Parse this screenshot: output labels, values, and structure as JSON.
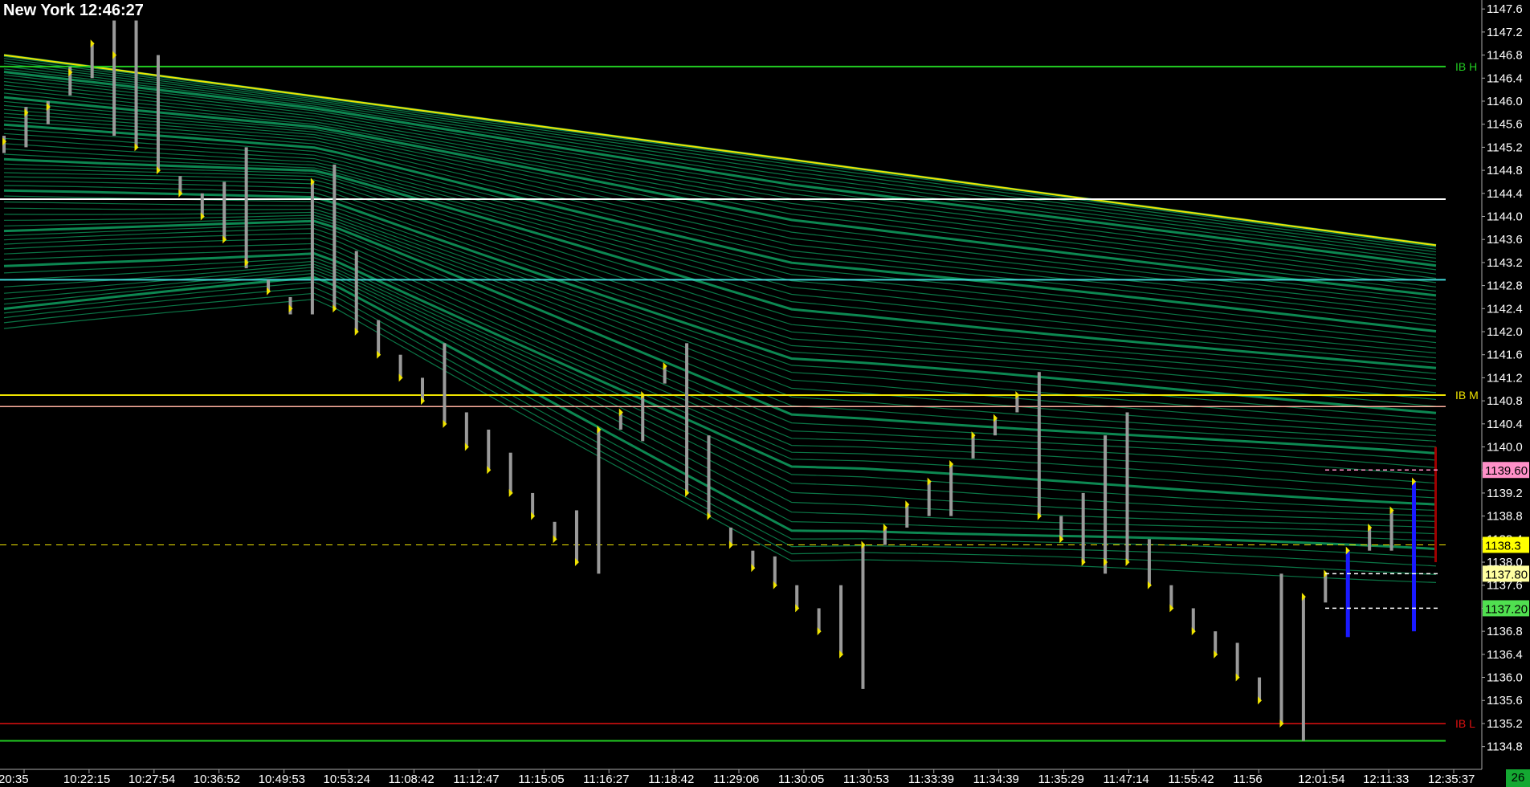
{
  "header": {
    "title": "New York 12:46:27"
  },
  "status": {
    "bar_count": "26"
  },
  "colors": {
    "background": "#000000",
    "fan": "#0d8a52",
    "fan_band": "#0fa060",
    "fan_top": "#f0e400",
    "bar": "#9a9a9a",
    "tick_mark": "#f0e400",
    "ib_high": "#22cc22",
    "ib_mid": "#f0e400",
    "ib_low": "#e01010",
    "white_line": "#ffffff",
    "cyan_line": "#40d8d8",
    "salmon_line": "#ffb0a0",
    "current_bar": "#1a1aff",
    "range_bar": "#a00000"
  },
  "chart_data": {
    "type": "bar",
    "ylim": [
      1134.6,
      1147.7
    ],
    "y_ticks": [
      "1147.6",
      "1147.2",
      "1146.8",
      "1146.4",
      "1146.0",
      "1145.6",
      "1145.2",
      "1144.8",
      "1144.4",
      "1144.0",
      "1143.6",
      "1143.2",
      "1142.8",
      "1142.4",
      "1142.0",
      "1141.6",
      "1141.2",
      "1140.8",
      "1140.4",
      "1140.0",
      "1139.6",
      "1139.2",
      "1138.8",
      "1138.4",
      "1138.0",
      "1137.6",
      "1137.2",
      "1136.8",
      "1136.4",
      "1136.0",
      "1135.6",
      "1135.2",
      "1134.8"
    ],
    "x_labels": [
      "20:35",
      "10:22:15",
      "10:27:54",
      "10:36:52",
      "10:49:53",
      "10:53:24",
      "11:08:42",
      "11:12:47",
      "11:15:05",
      "11:16:27",
      "11:18:42",
      "11:29:06",
      "11:30:05",
      "11:30:53",
      "11:33:39",
      "11:34:39",
      "11:35:29",
      "11:47:14",
      "11:55:42",
      "11:56",
      "12:01:54",
      "12:11:33",
      "12:35:37"
    ],
    "levels": [
      {
        "label": "IB H",
        "value": 1146.6,
        "style": "ib_high"
      },
      {
        "label": "",
        "value": 1144.3,
        "style": "white_line"
      },
      {
        "label": "",
        "value": 1142.9,
        "style": "cyan_line"
      },
      {
        "label": "IB M",
        "value": 1140.9,
        "style": "ib_mid"
      },
      {
        "label": "",
        "value": 1140.7,
        "style": "salmon_line"
      },
      {
        "label": "",
        "value": 1138.3,
        "style": "ib_mid_dash"
      },
      {
        "label": "IB L",
        "value": 1135.2,
        "style": "ib_low"
      },
      {
        "label": "",
        "value": 1134.9,
        "style": "ib_high"
      }
    ],
    "price_labels": [
      {
        "text": "1139.60",
        "value": 1139.6,
        "bg": "#ff90c8"
      },
      {
        "text": "1138.3",
        "value": 1138.3,
        "bg": "#ffff00"
      },
      {
        "text": "1137.80",
        "value": 1137.8,
        "bg": "#ffffa0"
      },
      {
        "text": "1137.20",
        "value": 1137.2,
        "bg": "#50e050"
      }
    ],
    "bars": [
      {
        "high": 1145.4,
        "low": 1145.1,
        "close": 1145.3
      },
      {
        "high": 1145.9,
        "low": 1145.2,
        "close": 1145.8
      },
      {
        "high": 1146.0,
        "low": 1145.6,
        "close": 1145.9
      },
      {
        "high": 1146.6,
        "low": 1146.1,
        "close": 1146.5
      },
      {
        "high": 1147.0,
        "low": 1146.4,
        "close": 1147.0
      },
      {
        "high": 1147.4,
        "low": 1145.4,
        "close": 1146.8
      },
      {
        "high": 1147.4,
        "low": 1145.2,
        "close": 1145.2
      },
      {
        "high": 1146.8,
        "low": 1144.8,
        "close": 1144.8
      },
      {
        "high": 1144.7,
        "low": 1144.4,
        "close": 1144.4
      },
      {
        "high": 1144.4,
        "low": 1144.0,
        "close": 1144.0
      },
      {
        "high": 1144.6,
        "low": 1143.6,
        "close": 1143.6
      },
      {
        "high": 1145.2,
        "low": 1143.1,
        "close": 1143.2
      },
      {
        "high": 1142.9,
        "low": 1142.7,
        "close": 1142.7
      },
      {
        "high": 1142.6,
        "low": 1142.3,
        "close": 1142.4
      },
      {
        "high": 1144.6,
        "low": 1142.3,
        "close": 1144.6
      },
      {
        "high": 1144.9,
        "low": 1142.4,
        "close": 1142.4
      },
      {
        "high": 1143.4,
        "low": 1142.0,
        "close": 1142.0
      },
      {
        "high": 1142.2,
        "low": 1141.6,
        "close": 1141.6
      },
      {
        "high": 1141.6,
        "low": 1141.2,
        "close": 1141.2
      },
      {
        "high": 1141.2,
        "low": 1140.8,
        "close": 1140.8
      },
      {
        "high": 1141.8,
        "low": 1140.4,
        "close": 1140.4
      },
      {
        "high": 1140.6,
        "low": 1140.0,
        "close": 1140.0
      },
      {
        "high": 1140.3,
        "low": 1139.6,
        "close": 1139.6
      },
      {
        "high": 1139.9,
        "low": 1139.2,
        "close": 1139.2
      },
      {
        "high": 1139.2,
        "low": 1138.8,
        "close": 1138.8
      },
      {
        "high": 1138.7,
        "low": 1138.4,
        "close": 1138.4
      },
      {
        "high": 1138.9,
        "low": 1138.0,
        "close": 1138.0
      },
      {
        "high": 1140.3,
        "low": 1137.8,
        "close": 1140.3
      },
      {
        "high": 1140.6,
        "low": 1140.3,
        "close": 1140.6
      },
      {
        "high": 1140.9,
        "low": 1140.1,
        "close": 1140.9
      },
      {
        "high": 1141.4,
        "low": 1141.1,
        "close": 1141.4
      },
      {
        "high": 1141.8,
        "low": 1139.2,
        "close": 1139.2
      },
      {
        "high": 1140.2,
        "low": 1138.8,
        "close": 1138.8
      },
      {
        "high": 1138.6,
        "low": 1138.3,
        "close": 1138.3
      },
      {
        "high": 1138.2,
        "low": 1137.9,
        "close": 1137.9
      },
      {
        "high": 1138.1,
        "low": 1137.6,
        "close": 1137.6
      },
      {
        "high": 1137.6,
        "low": 1137.2,
        "close": 1137.2
      },
      {
        "high": 1137.2,
        "low": 1136.8,
        "close": 1136.8
      },
      {
        "high": 1137.6,
        "low": 1136.4,
        "close": 1136.4
      },
      {
        "high": 1138.3,
        "low": 1135.8,
        "close": 1138.3
      },
      {
        "high": 1138.6,
        "low": 1138.3,
        "close": 1138.6
      },
      {
        "high": 1139.0,
        "low": 1138.6,
        "close": 1139.0
      },
      {
        "high": 1139.4,
        "low": 1138.8,
        "close": 1139.4
      },
      {
        "high": 1139.7,
        "low": 1138.8,
        "close": 1139.7
      },
      {
        "high": 1140.2,
        "low": 1139.8,
        "close": 1140.2
      },
      {
        "high": 1140.5,
        "low": 1140.2,
        "close": 1140.5
      },
      {
        "high": 1140.9,
        "low": 1140.6,
        "close": 1140.9
      },
      {
        "high": 1141.3,
        "low": 1138.8,
        "close": 1138.8
      },
      {
        "high": 1138.8,
        "low": 1138.4,
        "close": 1138.4
      },
      {
        "high": 1139.2,
        "low": 1138.0,
        "close": 1138.0
      },
      {
        "high": 1140.2,
        "low": 1137.8,
        "close": 1138.0
      },
      {
        "high": 1140.6,
        "low": 1138.0,
        "close": 1138.0
      },
      {
        "high": 1138.4,
        "low": 1137.6,
        "close": 1137.6
      },
      {
        "high": 1137.6,
        "low": 1137.2,
        "close": 1137.2
      },
      {
        "high": 1137.2,
        "low": 1136.8,
        "close": 1136.8
      },
      {
        "high": 1136.8,
        "low": 1136.4,
        "close": 1136.4
      },
      {
        "high": 1136.6,
        "low": 1136.0,
        "close": 1136.0
      },
      {
        "high": 1136.0,
        "low": 1135.6,
        "close": 1135.6
      },
      {
        "high": 1137.8,
        "low": 1135.2,
        "close": 1135.2
      },
      {
        "high": 1137.4,
        "low": 1134.9,
        "close": 1137.4
      },
      {
        "high": 1137.8,
        "low": 1137.3,
        "close": 1137.8
      },
      {
        "high": 1138.2,
        "low": 1136.7,
        "close": 1138.2,
        "current": true
      },
      {
        "high": 1138.6,
        "low": 1138.2,
        "close": 1138.6
      },
      {
        "high": 1138.9,
        "low": 1138.2,
        "close": 1138.9
      },
      {
        "high": 1139.4,
        "low": 1136.8,
        "close": 1139.4,
        "current": true
      }
    ]
  }
}
